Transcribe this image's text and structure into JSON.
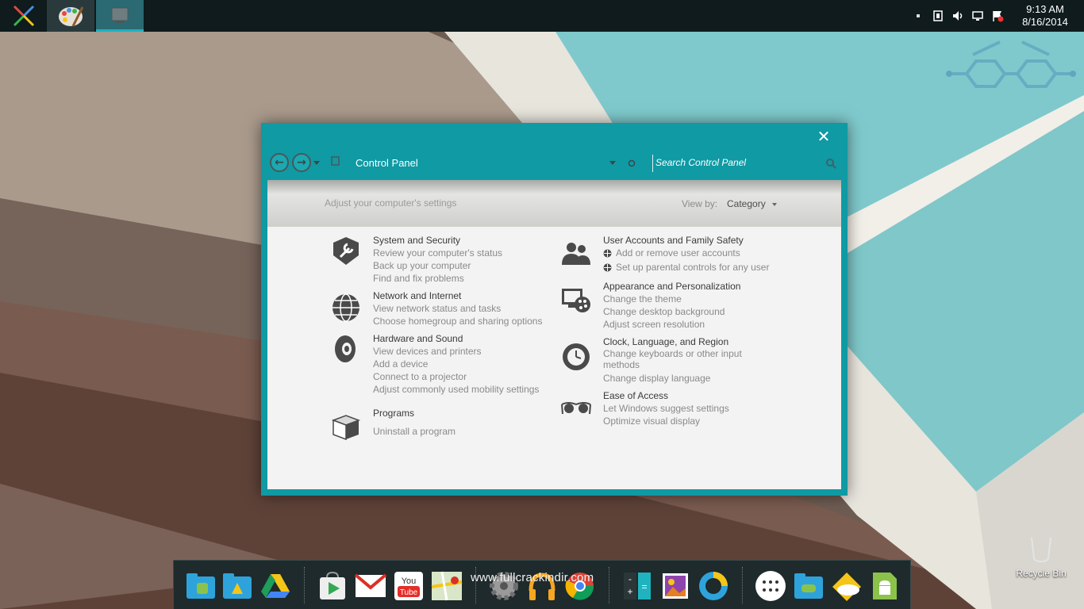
{
  "taskbar": {
    "clock_time": "9:13 AM",
    "clock_date": "8/16/2014",
    "tray_icons": [
      "tray-dot-icon",
      "network-plug-icon",
      "speaker-icon",
      "display-icon",
      "action-center-flag-icon"
    ]
  },
  "window": {
    "address": "Control Panel",
    "search_placeholder": "Search Control Panel",
    "header_text": "Adjust your computer's settings",
    "view_by_label": "View by:",
    "view_by_value": "Category",
    "categories": [
      {
        "title": "System and Security",
        "links": [
          "Review your computer's status",
          "Back up your computer",
          "Find and fix problems"
        ]
      },
      {
        "title": "Network and Internet",
        "links": [
          "View network status and tasks",
          "Choose homegroup and sharing options"
        ]
      },
      {
        "title": "Hardware and Sound",
        "links": [
          "View devices and printers",
          "Add a device",
          "Connect to a projector",
          "Adjust commonly used mobility settings"
        ]
      },
      {
        "title": "Programs",
        "links": [
          "Uninstall a program"
        ]
      },
      {
        "title": "User Accounts and Family Safety",
        "links": [
          "Add or remove user accounts",
          "Set up parental controls for any user"
        ]
      },
      {
        "title": "Appearance and Personalization",
        "links": [
          "Change the theme",
          "Change desktop background",
          "Adjust screen resolution"
        ]
      },
      {
        "title": "Clock, Language, and Region",
        "links": [
          "Change keyboards or other input",
          "methods",
          "Change display language"
        ]
      },
      {
        "title": "Ease of Access",
        "links": [
          "Let Windows suggest settings",
          "Optimize visual display"
        ]
      }
    ]
  },
  "desktop": {
    "recycle_bin_label": "Recycle Bin",
    "watermark": "www.fullcrackindir.com"
  },
  "colors": {
    "accent": "#0f9aa4",
    "taskbar": "#0f1b1c",
    "client_bg": "#f3f3f3"
  }
}
